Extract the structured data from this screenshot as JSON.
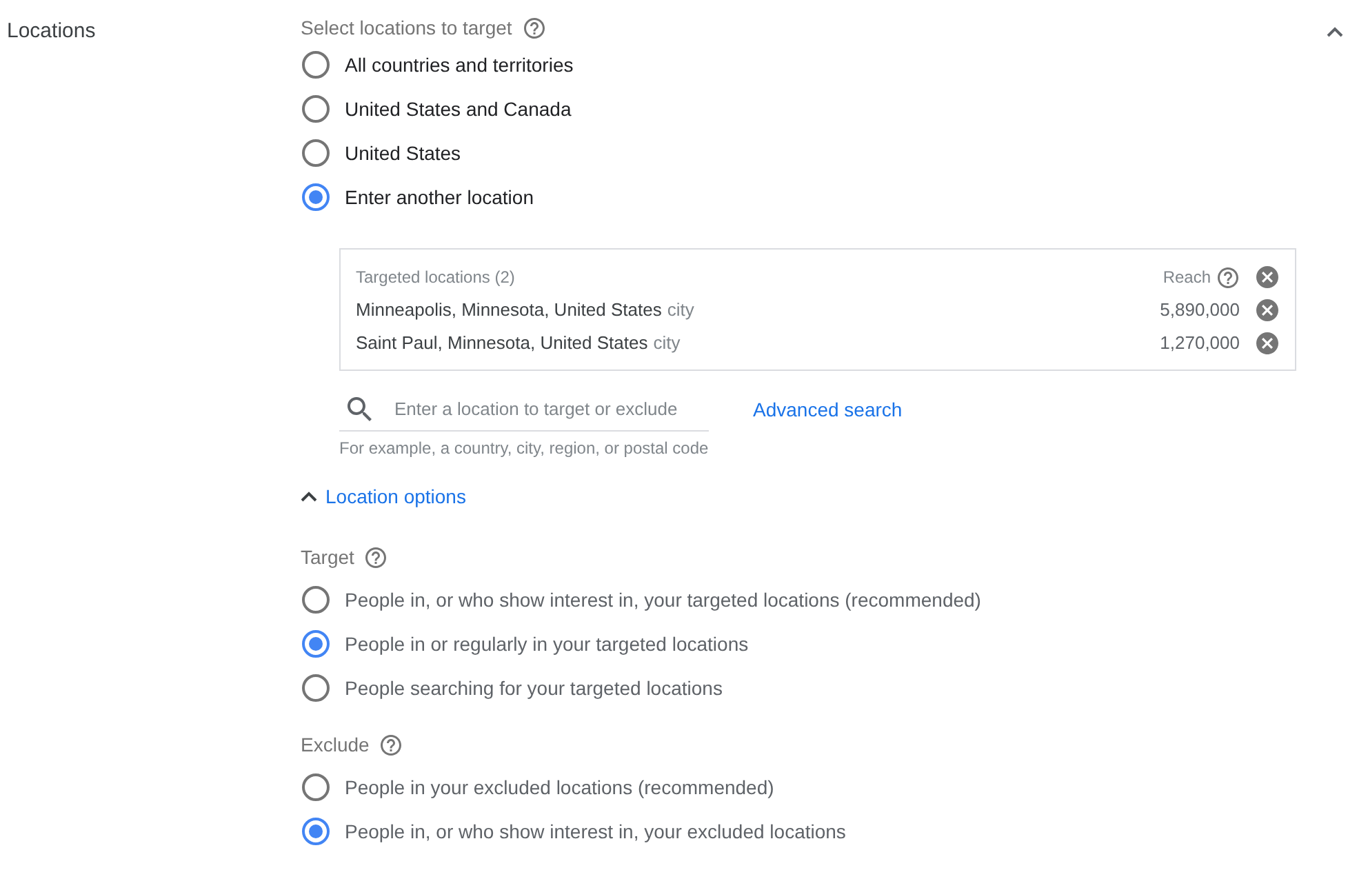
{
  "section": {
    "title": "Locations",
    "expanded": true
  },
  "select_locations": {
    "label": "Select locations to target",
    "options": [
      {
        "label": "All countries and territories",
        "selected": false
      },
      {
        "label": "United States and Canada",
        "selected": false
      },
      {
        "label": "United States",
        "selected": false
      },
      {
        "label": "Enter another location",
        "selected": true
      }
    ]
  },
  "targeted_locations": {
    "header": "Targeted locations (2)",
    "reach_label": "Reach",
    "rows": [
      {
        "name": "Minneapolis, Minnesota, United States",
        "type": "city",
        "reach": "5,890,000"
      },
      {
        "name": "Saint Paul, Minnesota, United States",
        "type": "city",
        "reach": "1,270,000"
      }
    ]
  },
  "location_search": {
    "placeholder": "Enter a location to target or exclude",
    "link": "Advanced search",
    "hint": "For example, a country, city, region, or postal code"
  },
  "location_options": {
    "label": "Location options",
    "expanded": true,
    "target": {
      "label": "Target",
      "options": [
        {
          "label": "People in, or who show interest in, your targeted locations (recommended)",
          "selected": false
        },
        {
          "label": "People in or regularly in your targeted locations",
          "selected": true
        },
        {
          "label": "People searching for your targeted locations",
          "selected": false
        }
      ]
    },
    "exclude": {
      "label": "Exclude",
      "options": [
        {
          "label": "People in your excluded locations (recommended)",
          "selected": false
        },
        {
          "label": "People in, or who show interest in, your excluded locations",
          "selected": true
        }
      ]
    }
  }
}
